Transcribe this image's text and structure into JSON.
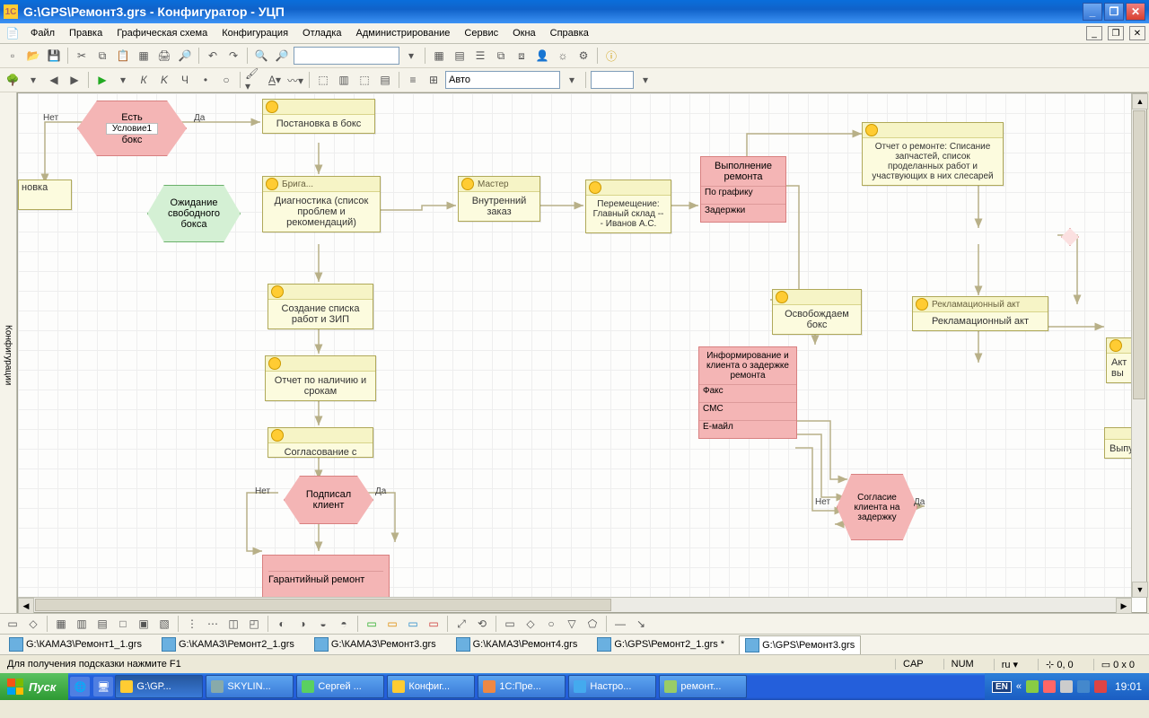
{
  "title": "G:\\GPS\\Ремонт3.grs - Конфигуратор - УЦП",
  "menu": [
    "Файл",
    "Правка",
    "Графическая схема",
    "Конфигурация",
    "Отладка",
    "Администрирование",
    "Сервис",
    "Окна",
    "Справка"
  ],
  "toolbar2_auto": "Авто",
  "sidepanel": "Конфигурации",
  "labels": {
    "no": "Нет",
    "yes": "Да",
    "condition": "Условие1"
  },
  "nodes": {
    "decision1_top": "Есть",
    "decision1_bot": "бокс",
    "wait": "Ожидание свободного бокса",
    "novka": "новка",
    "boxIn": {
      "hdr": "",
      "body": "Постановка в бокс"
    },
    "brigade": {
      "hdr": "Брига...",
      "body": "Диагностика (список проблем и рекомендаций)"
    },
    "createList": "Создание списка работ и ЗИП",
    "stockReport": "Отчет по наличию и срокам",
    "agree": "Согласование с клиентом",
    "clientSign": "Подписал клиент",
    "warranty": "Гарантийный ремонт",
    "master": {
      "hdr": "Мастер",
      "body": "Внутренний заказ"
    },
    "move": {
      "hdr": "",
      "body": "Перемещение: Главный склад -- - Иванов А.С."
    },
    "exec": {
      "title": "Выполнение ремонта",
      "r1": "По графику",
      "r2": "Задержки"
    },
    "free": "Освобождаем бокс",
    "inform": {
      "title": "Информирование и клиента о задержке ремонта",
      "r1": "Факс",
      "r2": "СМС",
      "r3": "Е-майл"
    },
    "consent": "Согласие клиента на задержку",
    "report": "Отчет о ремонте: Списание запчастей, список проделанных работ и участвующих в них слесарей",
    "reklAct": {
      "hdr": "Рекламационный акт",
      "body": "Рекламационный акт"
    },
    "aktVy": "Акт вы",
    "release": "Выпуск"
  },
  "doctabs": [
    "G:\\КАМАЗ\\Ремонт1_1.grs",
    "G:\\КАМАЗ\\Ремонт2_1.grs",
    "G:\\КАМАЗ\\Ремонт3.grs",
    "G:\\КАМАЗ\\Ремонт4.grs",
    "G:\\GPS\\Ремонт2_1.grs *",
    "G:\\GPS\\Ремонт3.grs"
  ],
  "status": {
    "hint": "Для получения подсказки нажмите F1",
    "cap": "CAP",
    "num": "NUM",
    "lang": "ru",
    "coord": "0, 0",
    "coord2": "0 x 0"
  },
  "taskbar": {
    "start": "Пуск",
    "tasks": [
      "G:\\GP...",
      "SKYLIN...",
      "Сергей ...",
      "Конфиг...",
      "1С:Пре...",
      "Настро...",
      "ремонт..."
    ],
    "lang": "EN",
    "clock": "19:01"
  }
}
